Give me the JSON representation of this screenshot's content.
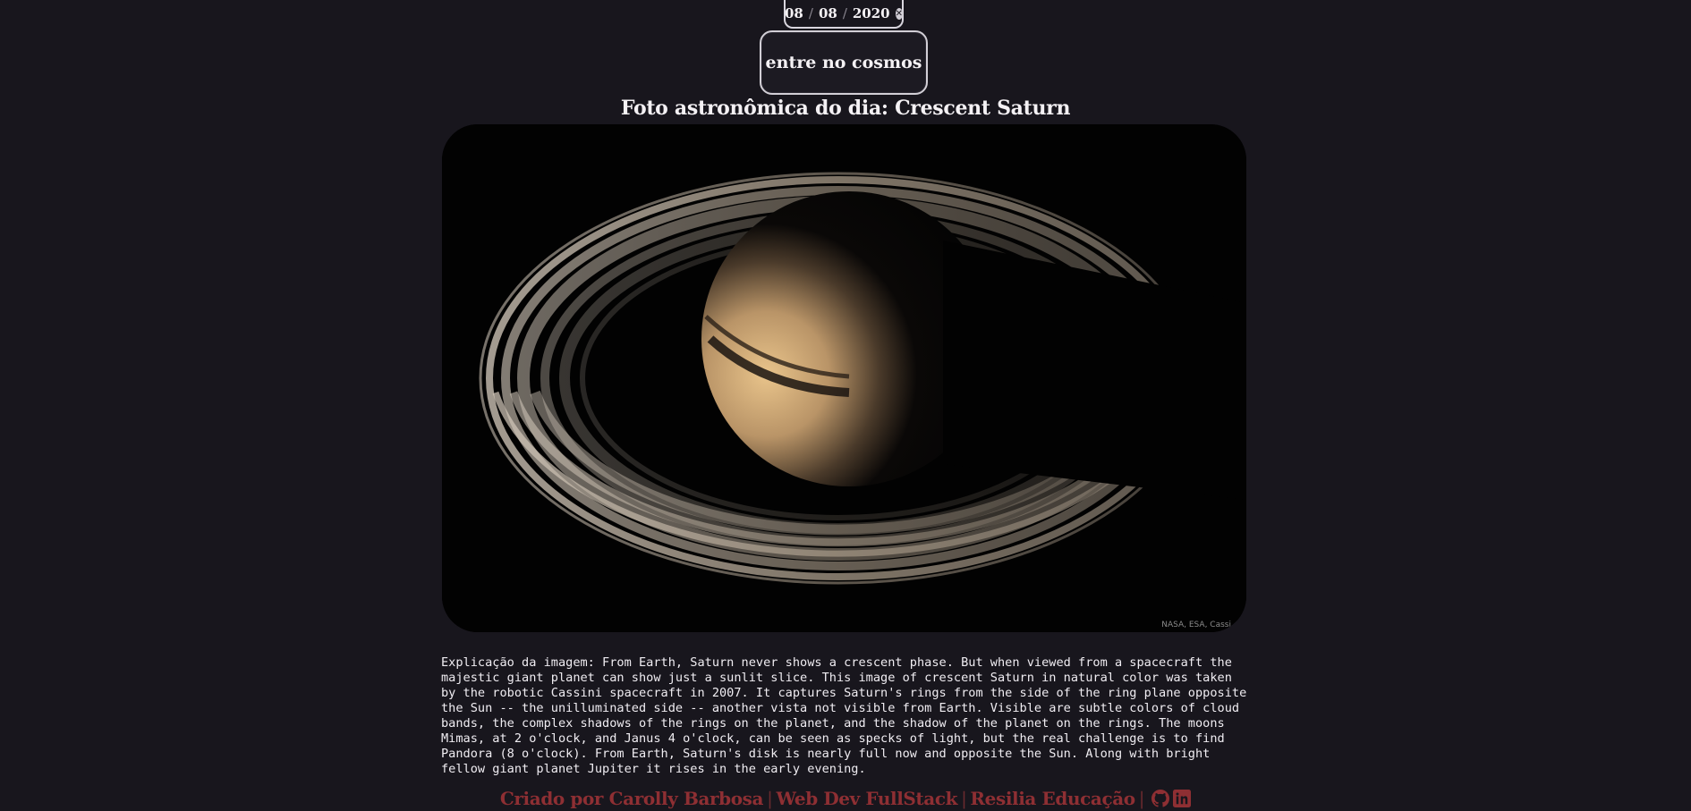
{
  "date_picker": {
    "day": "08",
    "month": "08",
    "year": "2020",
    "separator": "/",
    "clear_icon": "clear-circle-icon"
  },
  "enter_button": {
    "label": "entre no cosmos"
  },
  "title": "Foto astronômica do dia: Crescent Saturn",
  "image": {
    "subject": "Crescent Saturn",
    "credit": "NASA, ESA, Cassi"
  },
  "explanation": "Explicação da imagem: From Earth, Saturn never shows a crescent phase. But when viewed from a spacecraft the majestic giant planet can show just a sunlit slice. This image of crescent Saturn in natural color was taken by the robotic Cassini spacecraft in 2007. It captures Saturn's rings from the side of the ring plane opposite the Sun -- the unilluminated side -- another vista not visible from Earth. Visible are subtle colors of cloud bands, the complex shadows of the rings on the planet, and the shadow of the planet on the rings. The moons Mimas, at 2 o'clock, and Janus 4 o'clock, can be seen as specks of light, but the real challenge is to find Pandora (8 o'clock). From Earth, Saturn's disk is nearly full now and opposite the Sun. Along with bright fellow giant planet Jupiter it rises in the early evening.",
  "footer": {
    "author": "Criado por Carolly Barbosa",
    "course": "Web Dev FullStack",
    "school": "Resilia Educação",
    "github_icon": "github-icon",
    "linkedin_icon": "linkedin-icon"
  },
  "colors": {
    "background": "#18161d",
    "footer_accent": "#8e2f33",
    "text": "#f0edf2"
  }
}
